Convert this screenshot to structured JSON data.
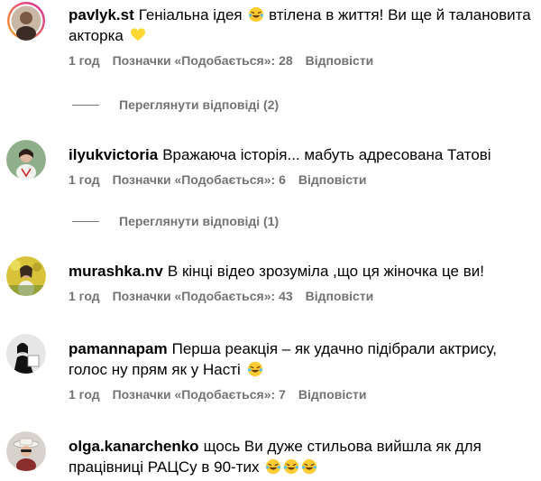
{
  "comments": [
    {
      "username": "pavlyk.st",
      "text": "Геніальна ідея",
      "text_after_emoji": "втілена в життя! Ви ще й талановита акторка",
      "emojis": [
        "laughing-face",
        "yellow-heart"
      ],
      "time": "1 год",
      "likes": "Позначки «Подобається»: 28",
      "reply": "Відповісти",
      "view_replies": "Переглянути відповіді (2)"
    },
    {
      "username": "ilyukvictoria",
      "text": "Вражаюча історія... мабуть адресована Татові",
      "time": "1 год",
      "likes": "Позначки «Подобається»: 6",
      "reply": "Відповісти",
      "view_replies": "Переглянути відповіді (1)"
    },
    {
      "username": "murashka.nv",
      "text": "В кінці відео зрозуміла ,що ця жіночка це ви!",
      "time": "1 год",
      "likes": "Позначки «Подобається»: 43",
      "reply": "Відповісти"
    },
    {
      "username": "pamannapam",
      "text": "Перша реакція – як удачно підібрали актрису, голос ну прям як у Насті",
      "emojis": [
        "laughing-face"
      ],
      "time": "1 год",
      "likes": "Позначки «Подобається»: 7",
      "reply": "Відповісти"
    },
    {
      "username": "olga.kanarchenko",
      "text": "щось Ви дуже стильова вийшла як для працівниці РАЦСу в 90-тих",
      "emojis": [
        "laughing-face",
        "laughing-face",
        "laughing-face"
      ]
    }
  ],
  "colors": {
    "text": "#000000",
    "muted": "#737373",
    "story_ring_start": "#f9a825",
    "story_ring_end": "#d6249f"
  }
}
